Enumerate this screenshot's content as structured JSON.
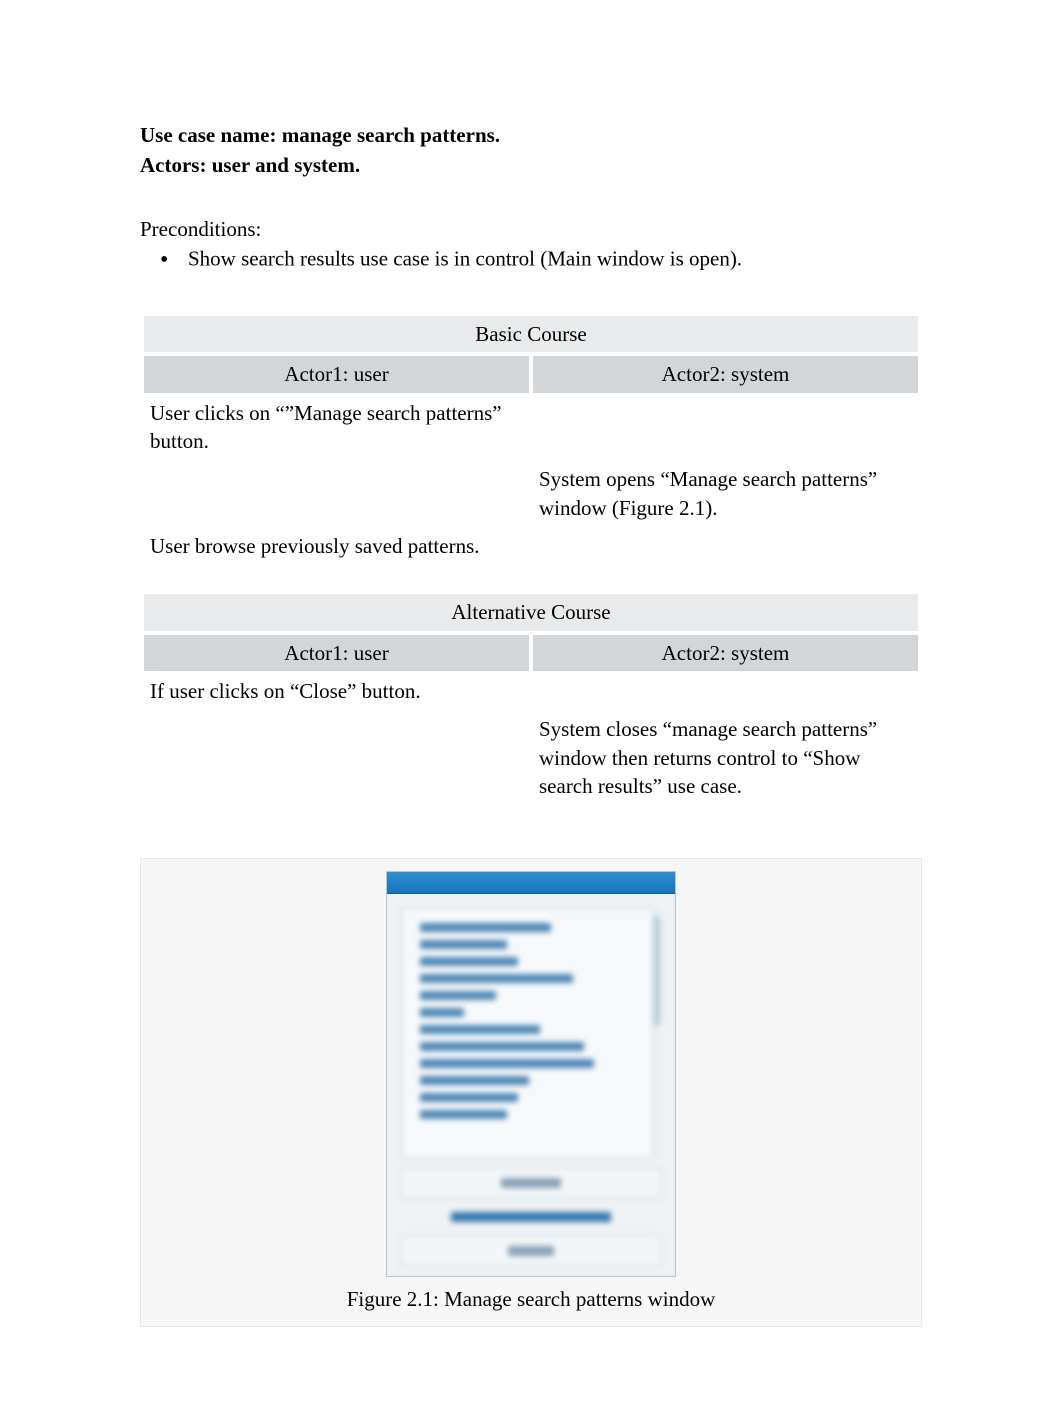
{
  "header": {
    "usecase_line": "Use case name: manage search patterns.",
    "actors_line": "Actors: user and system."
  },
  "preconditions": {
    "label": "Preconditions:",
    "items": [
      "Show search results use case is in control (Main window is open)."
    ]
  },
  "basic_course": {
    "title": "Basic Course",
    "actor1": "Actor1: user",
    "actor2": "Actor2: system",
    "rows": [
      {
        "left": "User clicks on “”Manage search patterns” button.",
        "right": ""
      },
      {
        "left": "",
        "right": "System opens “Manage search patterns” window (Figure 2.1)."
      },
      {
        "left": "User browse previously saved patterns.",
        "right": ""
      }
    ]
  },
  "alternative_course": {
    "title": "Alternative Course",
    "actor1": "Actor1: user",
    "actor2": "Actor2: system",
    "rows": [
      {
        "left": "If user clicks on “Close” button.",
        "right": ""
      },
      {
        "left": "",
        "right": "System closes “manage search patterns” window then returns control to “Show search results” use case."
      }
    ]
  },
  "figure": {
    "caption": "Figure 2.1: Manage search patterns window"
  }
}
